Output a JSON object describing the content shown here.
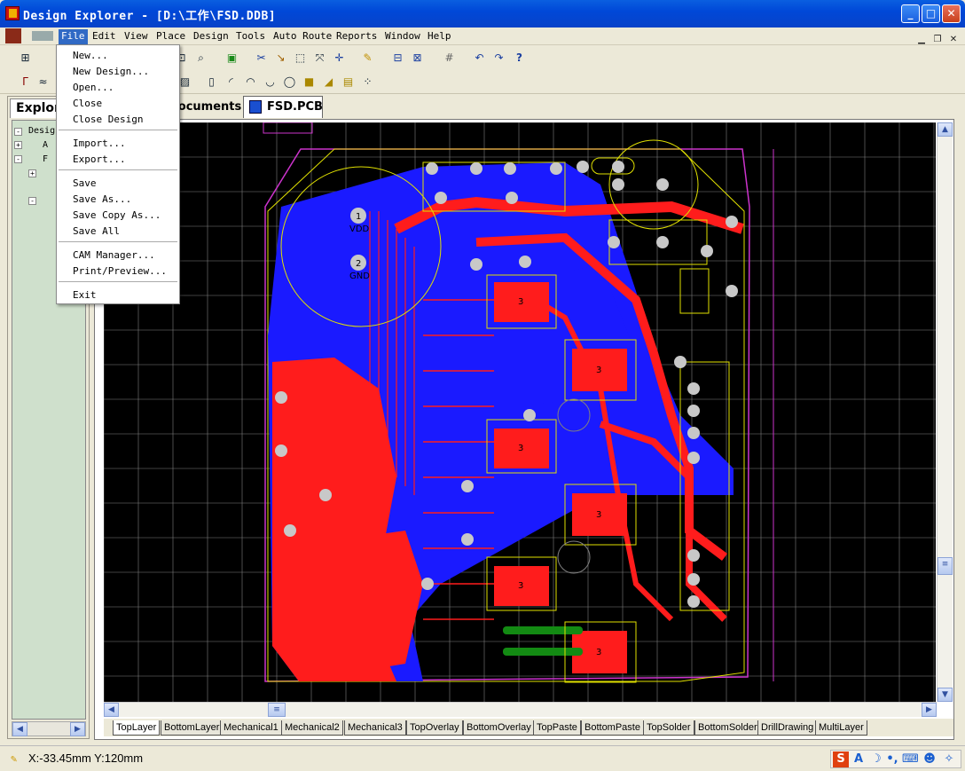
{
  "window": {
    "title": "Design Explorer - [D:\\工作\\FSD.DDB]"
  },
  "menubar": [
    "File",
    "Edit",
    "View",
    "Place",
    "Design",
    "Tools",
    "Auto Route",
    "Reports",
    "Window",
    "Help"
  ],
  "file_menu": {
    "items": [
      "New...",
      "New Design...",
      "Open...",
      "Close",
      "Close Design",
      "Import...",
      "Export...",
      "Save",
      "Save As...",
      "Save Copy As...",
      "Save All",
      "CAM Manager...",
      "Print/Preview...",
      "Exit"
    ]
  },
  "left_panel": {
    "tab": "Explorer",
    "tree": [
      "Design",
      "A",
      "F",
      "",
      ""
    ]
  },
  "doc_tabs": [
    "Documents",
    "FSD.PCB"
  ],
  "pcb_labels": {
    "vdd_pin": "1",
    "vdd": "VDD",
    "gnd_pin": "2",
    "gnd": "GND",
    "pad": "3"
  },
  "layer_tabs": [
    "TopLayer",
    "BottomLayer",
    "Mechanical1",
    "Mechanical2",
    "Mechanical3",
    "TopOverlay",
    "BottomOverlay",
    "TopPaste",
    "BottomPaste",
    "TopSolder",
    "BottomSolder",
    "DrillDrawing",
    "MultiLayer"
  ],
  "status": {
    "coords": "X:-33.45mm Y:120mm"
  },
  "colors": {
    "title_bar": "#0a5fe0",
    "top_layer": "#ff1c1c",
    "bottom_layer": "#1a1aff",
    "grid": "#808080",
    "overlay": "#ffff00",
    "keepout": "#cc33cc",
    "canvas": "#000000"
  },
  "icons": [
    "app-icon",
    "minimize-icon",
    "maximize-icon",
    "close-icon",
    "pcb-file-icon",
    "pencil-icon",
    "ime-s-icon",
    "ime-a-icon",
    "ime-moon-icon",
    "ime-dot-icon",
    "ime-keyboard-icon",
    "ime-user-icon",
    "ime-wrench-icon"
  ]
}
